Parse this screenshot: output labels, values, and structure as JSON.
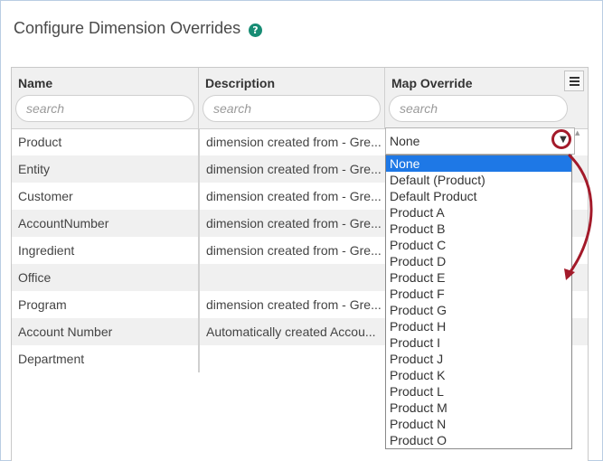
{
  "title": "Configure Dimension Overrides",
  "help_icon_glyph": "?",
  "columns": [
    {
      "label": "Name",
      "search_placeholder": "search"
    },
    {
      "label": "Description",
      "search_placeholder": "search"
    },
    {
      "label": "Map Override",
      "search_placeholder": "search"
    }
  ],
  "rows": [
    {
      "name": "Product",
      "description": "dimension created from - Gre..."
    },
    {
      "name": "Entity",
      "description": "dimension created from - Gre..."
    },
    {
      "name": "Customer",
      "description": "dimension created from - Gre..."
    },
    {
      "name": "AccountNumber",
      "description": "dimension created from - Gre..."
    },
    {
      "name": "Ingredient",
      "description": "dimension created from - Gre..."
    },
    {
      "name": "Office",
      "description": ""
    },
    {
      "name": "Program",
      "description": "dimension created from - Gre..."
    },
    {
      "name": "Account Number",
      "description": "Automatically created Accou..."
    },
    {
      "name": "Department",
      "description": ""
    }
  ],
  "map_override_select": {
    "value": "None"
  },
  "dropdown_options": [
    "None",
    "Default (Product)",
    "Default Product",
    "Product A",
    "Product B",
    "Product C",
    "Product D",
    "Product E",
    "Product F",
    "Product G",
    "Product H",
    "Product I",
    "Product J",
    "Product K",
    "Product L",
    "Product M",
    "Product N",
    "Product O"
  ],
  "selected_option_index": 0,
  "colors": {
    "accent": "#1e78e6",
    "help": "#178c74",
    "annotation": "#a31a2a"
  }
}
